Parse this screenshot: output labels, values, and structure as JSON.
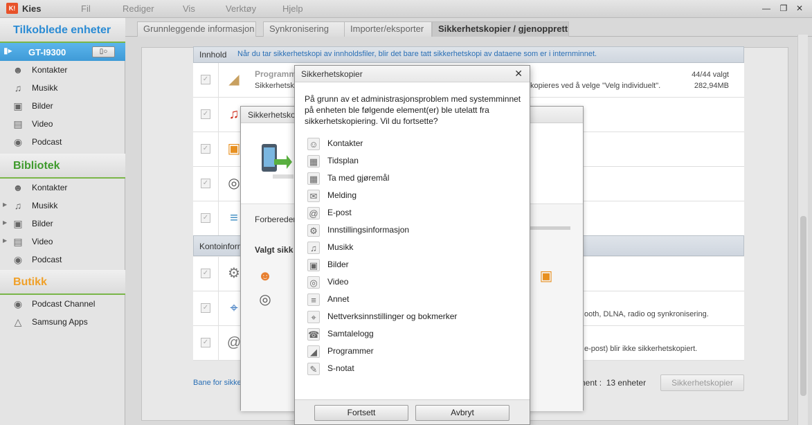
{
  "app": {
    "name": "Kies",
    "logo_text": "K!",
    "menu": [
      "Fil",
      "Rediger",
      "Vis",
      "Verktøy",
      "Hjelp"
    ],
    "window_controls": [
      "—",
      "❐",
      "✕"
    ]
  },
  "sidebar": {
    "connected_title": "Tilkoblede enheter",
    "device": {
      "name": "GT-I9300",
      "button_icon": "device-settings-icon"
    },
    "device_items": [
      {
        "label": "Kontakter",
        "icon": "contacts-icon"
      },
      {
        "label": "Musikk",
        "icon": "music-icon"
      },
      {
        "label": "Bilder",
        "icon": "pictures-icon"
      },
      {
        "label": "Video",
        "icon": "video-icon"
      },
      {
        "label": "Podcast",
        "icon": "podcast-icon"
      }
    ],
    "library_title": "Bibliotek",
    "library_items": [
      {
        "label": "Kontakter",
        "icon": "contacts-icon"
      },
      {
        "label": "Musikk",
        "icon": "music-icon"
      },
      {
        "label": "Bilder",
        "icon": "pictures-icon"
      },
      {
        "label": "Video",
        "icon": "video-icon"
      },
      {
        "label": "Podcast",
        "icon": "podcast-icon"
      }
    ],
    "shop_title": "Butikk",
    "shop_items": [
      {
        "label": "Podcast Channel",
        "icon": "podcast-icon"
      },
      {
        "label": "Samsung Apps",
        "icon": "apps-icon"
      }
    ]
  },
  "tabs": [
    {
      "label": "Grunnleggende informasjon",
      "active": false
    },
    {
      "label": "Synkronisering",
      "active": false
    },
    {
      "label": "Importer/eksporter",
      "active": false
    },
    {
      "label": "Sikkerhetskopier / gjenopprett",
      "active": true
    }
  ],
  "content": {
    "header_label": "Innhold",
    "header_note": "Når du tar sikkerhetskopi av innholdsfiler, blir det bare tatt sikkerhetskopi av dataene som er i internminnet.",
    "programs_title": "Programm",
    "programs_sub_left": "Sikkerhetsk",
    "programs_sub_right": "kopieres ved å velge \"Velg individuelt\".",
    "programs_count": "44/44 valgt",
    "programs_size": "282,94MB",
    "account_header": "Kontoinform",
    "account_row1_right": "ooth, DLNA, radio og synkronisering.",
    "account_row2_right": "e-post) blir ikke sikkerhetskopiert.",
    "path_label": "Bane for sikke",
    "count_label": "nent :",
    "count_value": "13 enheter",
    "backup_button": "Sikkerhetskopier"
  },
  "back_dialog": {
    "title": "Sikkerhetskop",
    "preparing": "Forbereder",
    "selected": "Valgt sikk"
  },
  "dialog": {
    "title": "Sikkerhetskopier",
    "close": "✕",
    "message": "På grunn av et administrasjonsproblem med systemminnet på enheten ble følgende element(er) ble utelatt fra sikkerhetskopiering. Vil du fortsette?",
    "items": [
      {
        "label": "Kontakter",
        "icon": "contacts-icon",
        "glyph": "☺"
      },
      {
        "label": "Tidsplan",
        "icon": "calendar-icon",
        "glyph": "▦"
      },
      {
        "label": "Ta med gjøremål",
        "icon": "tasks-icon",
        "glyph": "▦"
      },
      {
        "label": "Melding",
        "icon": "message-icon",
        "glyph": "✉"
      },
      {
        "label": "E-post",
        "icon": "email-icon",
        "glyph": "@"
      },
      {
        "label": "Innstillingsinformasjon",
        "icon": "settings-icon",
        "glyph": "⚙"
      },
      {
        "label": "Musikk",
        "icon": "music-icon",
        "glyph": "♫"
      },
      {
        "label": "Bilder",
        "icon": "pictures-icon",
        "glyph": "▣"
      },
      {
        "label": "Video",
        "icon": "video-icon",
        "glyph": "◎"
      },
      {
        "label": "Annet",
        "icon": "document-icon",
        "glyph": "≡"
      },
      {
        "label": "Nettverksinnstillinger og bokmerker",
        "icon": "network-icon",
        "glyph": "⌖"
      },
      {
        "label": "Samtalelogg",
        "icon": "call-log-icon",
        "glyph": "☎"
      },
      {
        "label": "Programmer",
        "icon": "programs-icon",
        "glyph": "◢"
      },
      {
        "label": "S-notat",
        "icon": "snote-icon",
        "glyph": "✎"
      }
    ],
    "continue_button": "Fortsett",
    "cancel_button": "Avbryt"
  }
}
